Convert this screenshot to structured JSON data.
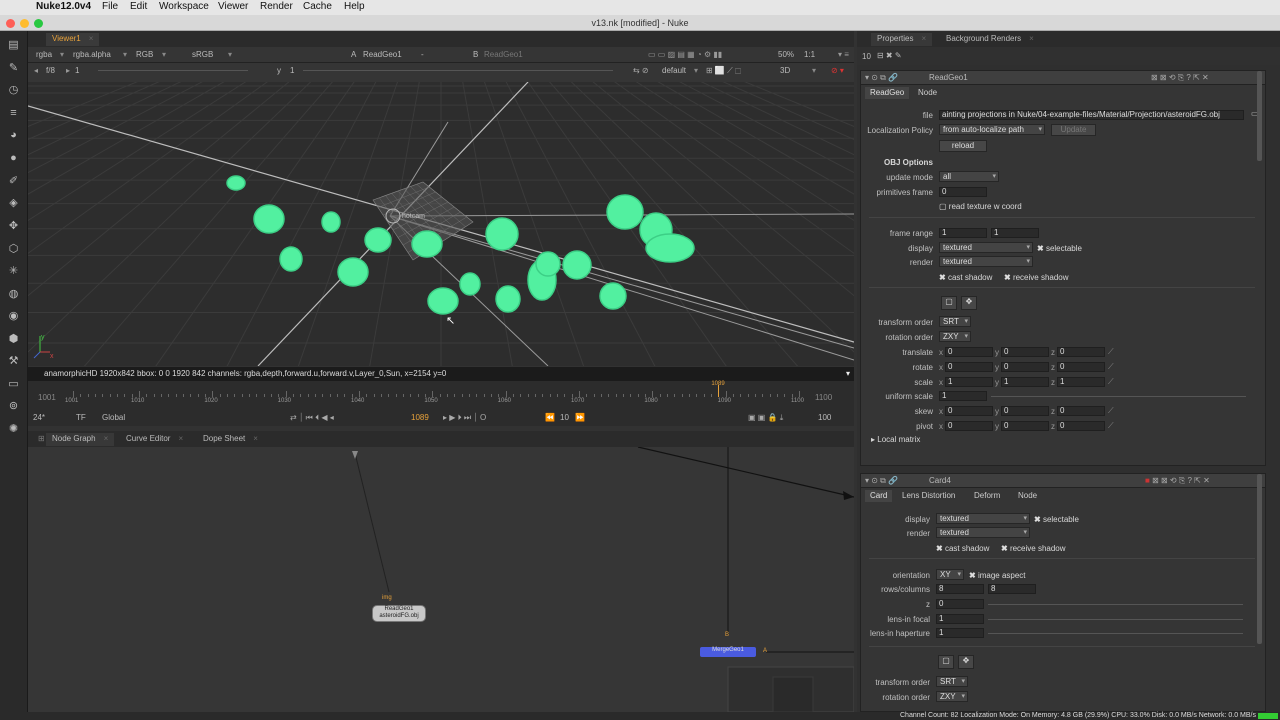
{
  "mac": {
    "app": "Nuke12.0v4",
    "menus": [
      "File",
      "Edit",
      "Workspace",
      "Viewer",
      "Render",
      "Cache",
      "Help"
    ]
  },
  "window": {
    "title": "v13.nk [modified] - Nuke"
  },
  "viewer": {
    "tab": "Viewer1",
    "channels": "rgba",
    "alpha": "rgba.alpha",
    "display": "RGB",
    "colorspace": "sRGB",
    "input_a_letter": "A",
    "input_a": "ReadGeo1",
    "input_a_sep": "-",
    "input_b_letter": "B",
    "input_b": "ReadGeo1",
    "zoom": "50%",
    "ratio": "1:1",
    "fstop": "f/8",
    "frame_field": "1",
    "y_label": "y",
    "y_value": "1",
    "camera": "default",
    "view_mode": "3D",
    "axis_x": "x",
    "axis_y": "y",
    "cam_label": "hotcam"
  },
  "status_line": "anamorphicHD 1920x842  bbox: 0 0 1920 842 channels: rgba,depth,forward.u,forward.v,Layer_0,Sun,  x=2154 y=0",
  "timeline": {
    "start": "1001",
    "end": "1100",
    "ticks": [
      "1001",
      "1010",
      "1020",
      "1030",
      "1040",
      "1050",
      "1060",
      "1070",
      "1080",
      "1090",
      "1100"
    ],
    "current": "1089",
    "fps": "24*",
    "tf": "TF",
    "scope": "Global",
    "step": "10",
    "end_field": "100",
    "playhead_label": "1089"
  },
  "nodegraph": {
    "tabs": [
      "Node Graph",
      "Curve Editor",
      "Dope Sheet"
    ],
    "img_label": "img",
    "node_name": "ReadGeo1",
    "node_file": "asteroidFG.obj",
    "b_label": "B",
    "a_label": "A",
    "merge_node": "MergeGeo1"
  },
  "properties": {
    "tabs": [
      "Properties",
      "Background Renders"
    ],
    "count": "10"
  },
  "readgeo": {
    "name": "ReadGeo1",
    "subtabs": [
      "ReadGeo",
      "Node"
    ],
    "file_label": "file",
    "file": "ainting projections in Nuke/04-example-files/Material/Projection/asteroidFG.obj",
    "loc_label": "Localization Policy",
    "loc_value": "from auto-localize path",
    "update_btn": "Update",
    "reload_btn": "reload",
    "section": "OBJ Options",
    "update_mode_label": "update mode",
    "update_mode": "all",
    "prim_label": "primitives frame",
    "prim_value": "0",
    "read_tex": "read texture w coord",
    "frame_range_label": "frame range",
    "fr1": "1",
    "fr2": "1",
    "display_label": "display",
    "display": "textured",
    "selectable": "selectable",
    "render_label": "render",
    "render": "textured",
    "cast": "cast shadow",
    "receive": "receive shadow",
    "torder_label": "transform order",
    "torder": "SRT",
    "rorder_label": "rotation order",
    "rorder": "ZXY",
    "rows": [
      {
        "label": "translate",
        "x": "0",
        "y": "0",
        "z": "0"
      },
      {
        "label": "rotate",
        "x": "0",
        "y": "0",
        "z": "0"
      },
      {
        "label": "scale",
        "x": "1",
        "y": "1",
        "z": "1"
      }
    ],
    "uscale_label": "uniform scale",
    "uscale": "1",
    "rows2": [
      {
        "label": "skew",
        "x": "0",
        "y": "0",
        "z": "0"
      },
      {
        "label": "pivot",
        "x": "0",
        "y": "0",
        "z": "0"
      }
    ],
    "local_matrix": "Local matrix"
  },
  "card": {
    "name": "Card4",
    "subtabs": [
      "Card",
      "Lens Distortion",
      "Deform",
      "Node"
    ],
    "display_label": "display",
    "display": "textured",
    "selectable": "selectable",
    "render_label": "render",
    "render": "textured",
    "cast": "cast shadow",
    "receive": "receive shadow",
    "orient_label": "orientation",
    "orient": "XY",
    "aspect": "image aspect",
    "rc_label": "rows/columns",
    "rc1": "8",
    "rc2": "8",
    "z_label": "z",
    "z": "0",
    "focal_label": "lens-in focal",
    "focal": "1",
    "haperture_label": "lens-in haperture",
    "haperture": "1",
    "torder_label": "transform order",
    "torder": "SRT",
    "rorder_label": "rotation order",
    "rorder": "ZXY"
  },
  "statusbar": "Channel Count: 82 Localization Mode: On Memory: 4.8 GB (29.9%) CPU: 33.0% Disk: 0.0 MB/s Network: 0.0 MB/s",
  "colors": {
    "asteroid": "#52f0a0",
    "accent": "#e8a23a",
    "bg": "#323232"
  }
}
